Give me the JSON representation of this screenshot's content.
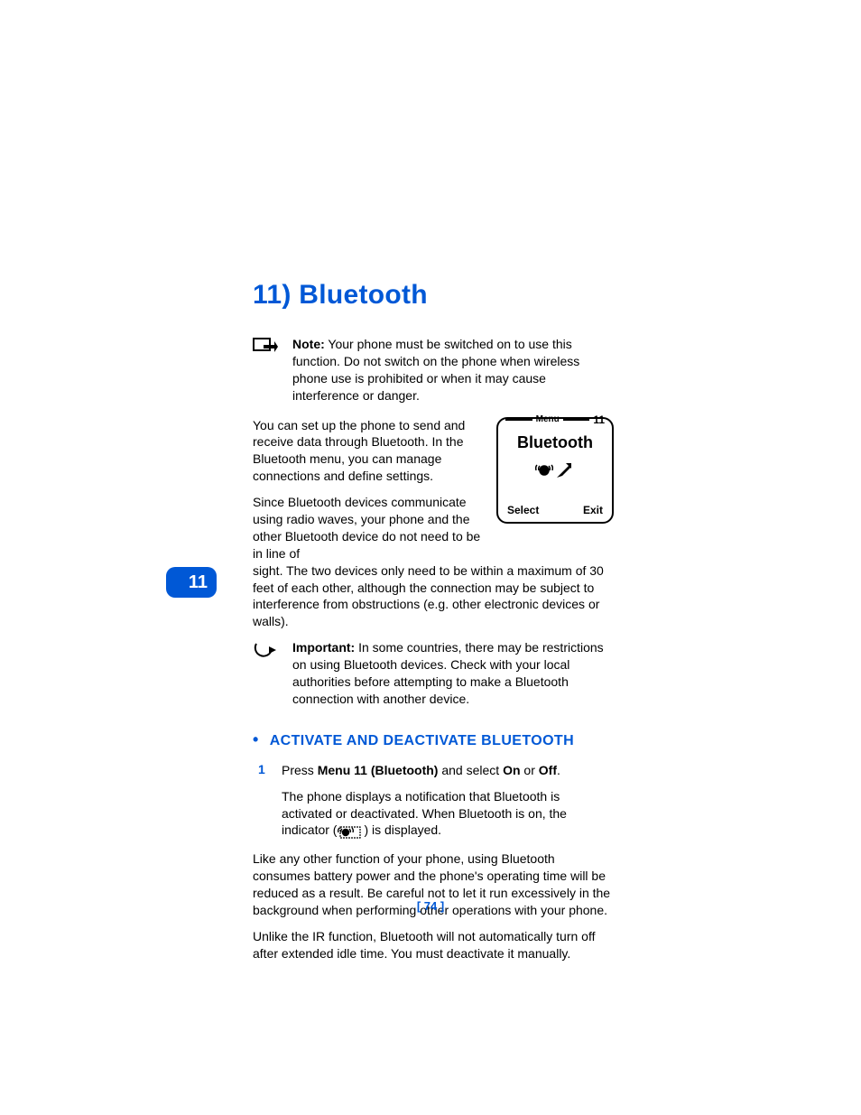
{
  "chapter": {
    "title": "11) Bluetooth"
  },
  "tab": {
    "number": "11"
  },
  "note": {
    "label": "Note:",
    "text": "Your phone must be switched on to use this function. Do not switch on the phone when wireless phone use is prohibited or when it may cause interference or danger."
  },
  "intro": [
    "You can set up the phone to send and receive data through Bluetooth. In the Bluetooth menu, you can manage connections and define settings.",
    "Since Bluetooth devices communicate using radio waves, your phone and the other Bluetooth device do not need to be in line of",
    "sight. The two devices only need to be within a maximum of 30 feet of each other, although the connection may be subject to interference from obstructions (e.g. other electronic devices or walls)."
  ],
  "phone": {
    "menu_label": "Menu",
    "menu_number": "11",
    "title": "Bluetooth",
    "soft_left": "Select",
    "soft_right": "Exit"
  },
  "important": {
    "label": "Important:",
    "text": "In some countries, there may be restrictions on using Bluetooth devices. Check with your local authorities before attempting to make a Bluetooth connection with another device."
  },
  "section1": {
    "bullet": "•",
    "title": "ACTIVATE AND DEACTIVATE BLUETOOTH"
  },
  "step1": {
    "num": "1",
    "pre": "Press ",
    "bold1": "Menu 11 (Bluetooth)",
    "mid": " and select ",
    "bold2": "On",
    "mid2": " or ",
    "bold3": "Off",
    "post": "."
  },
  "step1_sub_a": "The phone displays a notification that Bluetooth is activated or deactivated. When Bluetooth is on, the indicator (",
  "step1_sub_b": ") is displayed.",
  "body_after": [
    "Like any other function of your phone, using Bluetooth consumes battery power and the phone's operating time will be reduced as a result. Be careful not to let it run excessively in the background when performing other operations with your phone.",
    "Unlike the IR function, Bluetooth will not automatically turn off after extended idle time. You must deactivate it manually."
  ],
  "page_number": "[ 74 ]"
}
